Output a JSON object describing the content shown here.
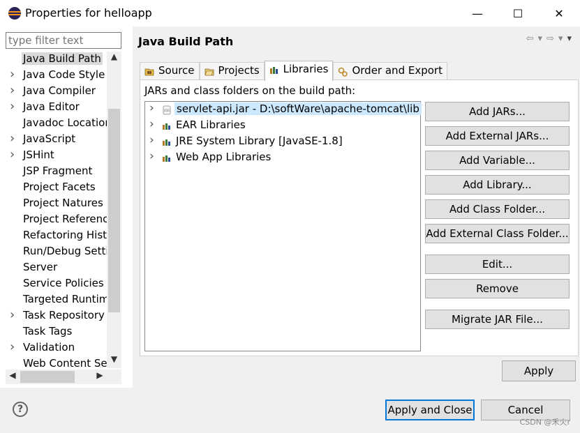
{
  "window": {
    "title": "Properties for helloapp",
    "minimize": "—",
    "maximize": "☐",
    "close": "✕"
  },
  "filter": {
    "placeholder": "type filter text"
  },
  "nav_tree": {
    "items": [
      {
        "label": "Java Build Path",
        "expandable": false,
        "selected": true
      },
      {
        "label": "Java Code Style",
        "expandable": true
      },
      {
        "label": "Java Compiler",
        "expandable": true
      },
      {
        "label": "Java Editor",
        "expandable": true
      },
      {
        "label": "Javadoc Location",
        "expandable": false
      },
      {
        "label": "JavaScript",
        "expandable": true
      },
      {
        "label": "JSHint",
        "expandable": true
      },
      {
        "label": "JSP Fragment",
        "expandable": false
      },
      {
        "label": "Project Facets",
        "expandable": false
      },
      {
        "label": "Project Natures",
        "expandable": false
      },
      {
        "label": "Project References",
        "expandable": false
      },
      {
        "label": "Refactoring History",
        "expandable": false
      },
      {
        "label": "Run/Debug Settings",
        "expandable": false
      },
      {
        "label": "Server",
        "expandable": false
      },
      {
        "label": "Service Policies",
        "expandable": false
      },
      {
        "label": "Targeted Runtimes",
        "expandable": false
      },
      {
        "label": "Task Repository",
        "expandable": true
      },
      {
        "label": "Task Tags",
        "expandable": false
      },
      {
        "label": "Validation",
        "expandable": true
      },
      {
        "label": "Web Content Settings",
        "expandable": false
      }
    ]
  },
  "page": {
    "title": "Java Build Path",
    "tabs": [
      {
        "label": "Source",
        "icon": "source-folder-icon"
      },
      {
        "label": "Projects",
        "icon": "projects-folder-icon"
      },
      {
        "label": "Libraries",
        "icon": "libraries-icon",
        "active": true
      },
      {
        "label": "Order and Export",
        "icon": "order-export-icon"
      }
    ],
    "jars_label": "JARs and class folders on the build path:",
    "libraries": [
      {
        "label": "servlet-api.jar - D:\\softWare\\apache-tomcat\\lib",
        "icon": "jar-icon",
        "selected": true
      },
      {
        "label": "EAR Libraries",
        "icon": "library-icon"
      },
      {
        "label": "JRE System Library [JavaSE-1.8]",
        "icon": "library-icon"
      },
      {
        "label": "Web App Libraries",
        "icon": "library-icon"
      }
    ],
    "buttons": {
      "add_jars": "Add JARs...",
      "add_external_jars": "Add External JARs...",
      "add_variable": "Add Variable...",
      "add_library": "Add Library...",
      "add_class_folder": "Add Class Folder...",
      "add_external_class_folder": "Add External Class Folder...",
      "edit": "Edit...",
      "remove": "Remove",
      "migrate_jar": "Migrate JAR File..."
    },
    "apply": "Apply"
  },
  "footer": {
    "help": "?",
    "apply_and_close": "Apply and Close",
    "cancel": "Cancel"
  },
  "watermark": "CSDN @禾火r"
}
